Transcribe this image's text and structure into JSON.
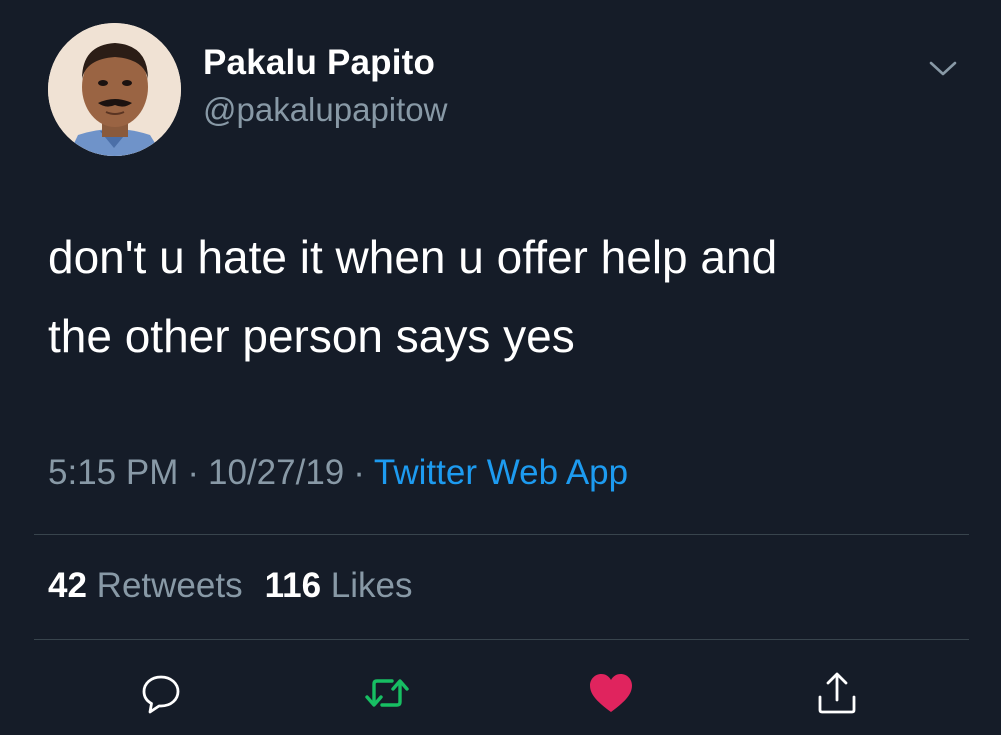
{
  "user": {
    "display_name": "Pakalu Papito",
    "handle": "@pakalupapitow",
    "avatar_icon": "profile-photo"
  },
  "tweet": {
    "text_line_1": "don't u hate it when u offer help and",
    "text_line_2": "the other person says yes",
    "time": "5:15 PM",
    "date": "10/27/19",
    "separator": "·",
    "source": "Twitter Web App"
  },
  "stats": {
    "retweets_count": "42",
    "retweets_label": "Retweets",
    "likes_count": "116",
    "likes_label": "Likes"
  },
  "actions": {
    "reply_icon": "reply-icon",
    "retweet_icon": "retweet-icon",
    "like_icon": "heart-icon",
    "share_icon": "share-icon",
    "retweet_color": "#17bf63",
    "like_color": "#e0245e"
  },
  "theme": {
    "background": "#151c28",
    "link_color": "#1d9bf0",
    "secondary_text": "#8899a6"
  }
}
